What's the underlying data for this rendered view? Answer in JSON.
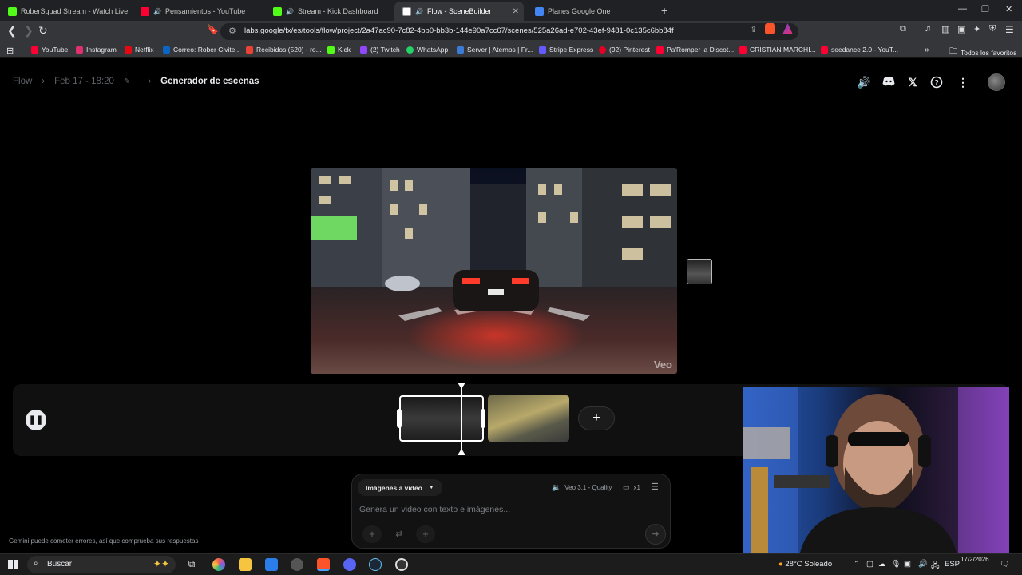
{
  "browser": {
    "tabs": [
      {
        "title": "RoberSquad Stream - Watch Live",
        "color": "#53fc18"
      },
      {
        "title": "Pensamientos - YouTube",
        "color": "#ff0033"
      },
      {
        "title": "Stream - Kick Dashboard",
        "color": "#53fc18"
      },
      {
        "title": "Flow - SceneBuilder",
        "color": "#ffffff"
      },
      {
        "title": "Planes Google One",
        "color": "#4285f4"
      }
    ],
    "new_tab_label": "+",
    "url": "labs.google/fx/es/tools/flow/project/2a47ac90-7c82-4bb0-bb3b-144e90a7cc67/scenes/525a26ad-e702-43ef-9481-0c135c6bb84f",
    "bookmarks": [
      {
        "label": "YouTube",
        "color": "#ff0033"
      },
      {
        "label": "Instagram",
        "color": "#e1306c"
      },
      {
        "label": "Netflix",
        "color": "#e50914"
      },
      {
        "label": "Correo: Rober Civite...",
        "color": "#0a66c2"
      },
      {
        "label": "Recibidos (520) - ro...",
        "color": "#ea4335"
      },
      {
        "label": "Kick",
        "color": "#53fc18"
      },
      {
        "label": "(2) Twitch",
        "color": "#9146ff"
      },
      {
        "label": "WhatsApp",
        "color": "#25d366"
      },
      {
        "label": "Server | Aternos | Fr...",
        "color": "#3d7bd9"
      },
      {
        "label": "Stripe Express",
        "color": "#635bff"
      },
      {
        "label": "(92) Pinterest",
        "color": "#e60023"
      },
      {
        "label": "Pa'Romper la Discot...",
        "color": "#ff0033"
      },
      {
        "label": "CRISTIAN MARCHI...",
        "color": "#ff0033"
      },
      {
        "label": "seedance 2.0 - YouT...",
        "color": "#ff0033"
      }
    ],
    "all_bookmarks_label": "Todos los favoritos"
  },
  "header": {
    "app_name": "Flow",
    "project_date": "Feb 17 - 18:20",
    "page_title": "Generador de escenas",
    "edit_icon": "pencil-icon",
    "icons": [
      "volume-icon",
      "discord-icon",
      "x-icon",
      "help-icon",
      "more-vert-icon"
    ]
  },
  "preview": {
    "watermark": "Veo"
  },
  "timeline": {
    "play_state": "paused",
    "add_label": "+",
    "clips": 2
  },
  "composer": {
    "mode_label": "Imágenes a video",
    "model_label": "Veo 3.1 - Quality",
    "output_count": "x1",
    "placeholder": "Genera un video con texto e imágenes..."
  },
  "disclaimer": "Gemini puede cometer errores, así que comprueba sus respuestas",
  "taskbar": {
    "search_label": "Buscar",
    "weather": "28°C  Soleado",
    "language": "ESP",
    "time": "",
    "date": "17/2/2026"
  },
  "colors": {
    "page_bg": "#000000",
    "accent_text": "#e8eaed",
    "muted_text": "#5f6368"
  }
}
